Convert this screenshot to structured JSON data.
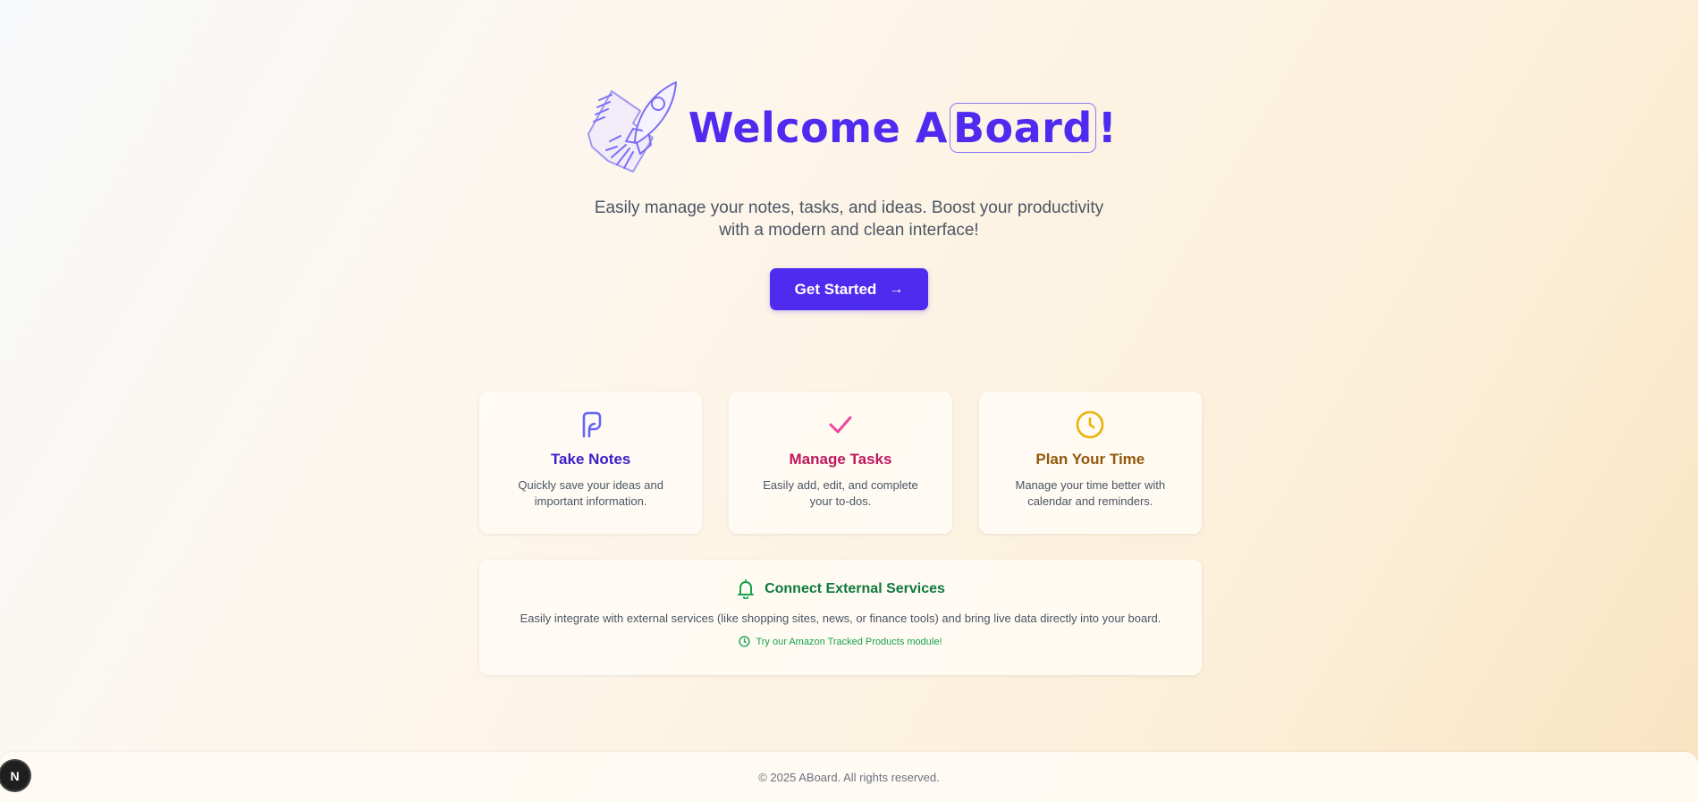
{
  "hero": {
    "title_pre": "Welcome A",
    "title_boxed": "Board",
    "title_post": "!",
    "subtitle": "Easily manage your notes, tasks, and ideas. Boost your productivity with a modern and clean interface!",
    "cta_label": "Get Started",
    "logo_icon": "rocket-icon"
  },
  "features": [
    {
      "title": "Take Notes",
      "description": "Quickly save your ideas and important information.",
      "icon": "note-icon",
      "color": "#3b20c8",
      "icon_color": "#6366f1"
    },
    {
      "title": "Manage Tasks",
      "description": "Easily add, edit, and complete your to-dos.",
      "icon": "check-icon",
      "color": "#be185d",
      "icon_color": "#ec4899"
    },
    {
      "title": "Plan Your Time",
      "description": "Manage your time better with calendar and reminders.",
      "icon": "clock-icon",
      "color": "#92580c",
      "icon_color": "#eab308"
    }
  ],
  "external": {
    "title": "Connect External Services",
    "description": "Easily integrate with external services (like shopping sites, news, or finance tools) and bring live data directly into your board.",
    "link": "Try our Amazon Tracked Products module!",
    "icon": "bell-icon",
    "color": "#16a34a"
  },
  "footer": {
    "text": "© 2025 ABoard. All rights reserved."
  },
  "badge": {
    "letter": "N"
  },
  "colors": {
    "accent": "#4f2bf0"
  }
}
